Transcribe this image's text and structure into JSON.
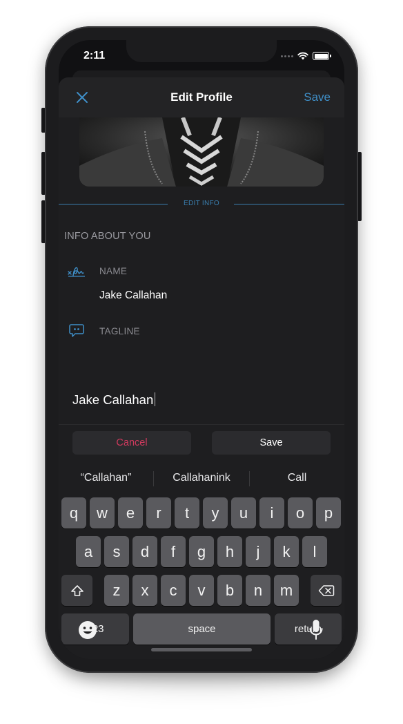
{
  "status_bar": {
    "time": "2:11"
  },
  "nav": {
    "title": "Edit Profile",
    "save_label": "Save"
  },
  "divider": {
    "label": "EDIT INFO"
  },
  "info": {
    "section_title": "INFO ABOUT YOU",
    "name_label": "NAME",
    "name_value": "Jake Callahan",
    "tagline_label": "TAGLINE"
  },
  "editor": {
    "input_value": "Jake Callahan",
    "cancel_label": "Cancel",
    "save_label": "Save"
  },
  "keyboard": {
    "suggestions": [
      "“Callahan”",
      "Callahanink",
      "Call"
    ],
    "row1": [
      "q",
      "w",
      "e",
      "r",
      "t",
      "y",
      "u",
      "i",
      "o",
      "p"
    ],
    "row2": [
      "a",
      "s",
      "d",
      "f",
      "g",
      "h",
      "j",
      "k",
      "l"
    ],
    "row3": [
      "z",
      "x",
      "c",
      "v",
      "b",
      "n",
      "m"
    ],
    "numbers_label": "123",
    "space_label": "space",
    "return_label": "return"
  },
  "colors": {
    "accent": "#3f8fc8",
    "cancel": "#d03a5e",
    "background": "#1e1e20",
    "key": "#5a5a5e"
  }
}
